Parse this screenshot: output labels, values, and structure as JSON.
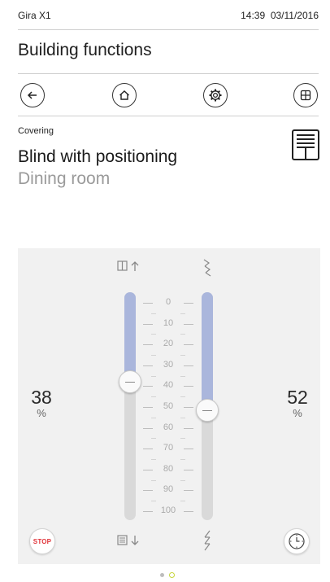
{
  "status_bar": {
    "app_name": "Gira X1",
    "time": "14:39",
    "date": "03/11/2016"
  },
  "header": {
    "title": "Building functions"
  },
  "nav": {
    "icons": [
      "back-arrow-icon",
      "home-icon",
      "settings-gear-icon",
      "grid-icon"
    ]
  },
  "function": {
    "category": "Covering",
    "name": "Blind with positioning",
    "room": "Dining room",
    "icon": "blind-icon"
  },
  "control": {
    "scale_labels": [
      "0",
      "10",
      "20",
      "30",
      "40",
      "50",
      "60",
      "70",
      "80",
      "90",
      "100"
    ],
    "blind_position": {
      "value": "38",
      "unit": "%",
      "level_percent": 38
    },
    "slat_position": {
      "value": "52",
      "unit": "%",
      "level_percent": 52
    },
    "stop_label": "STOP"
  },
  "pagination": {
    "pages": 2,
    "active": 1
  },
  "colors": {
    "accent_fill": "#aab6dc",
    "stop_red": "#e0343a",
    "page_dot_active": "#c7d63a"
  }
}
